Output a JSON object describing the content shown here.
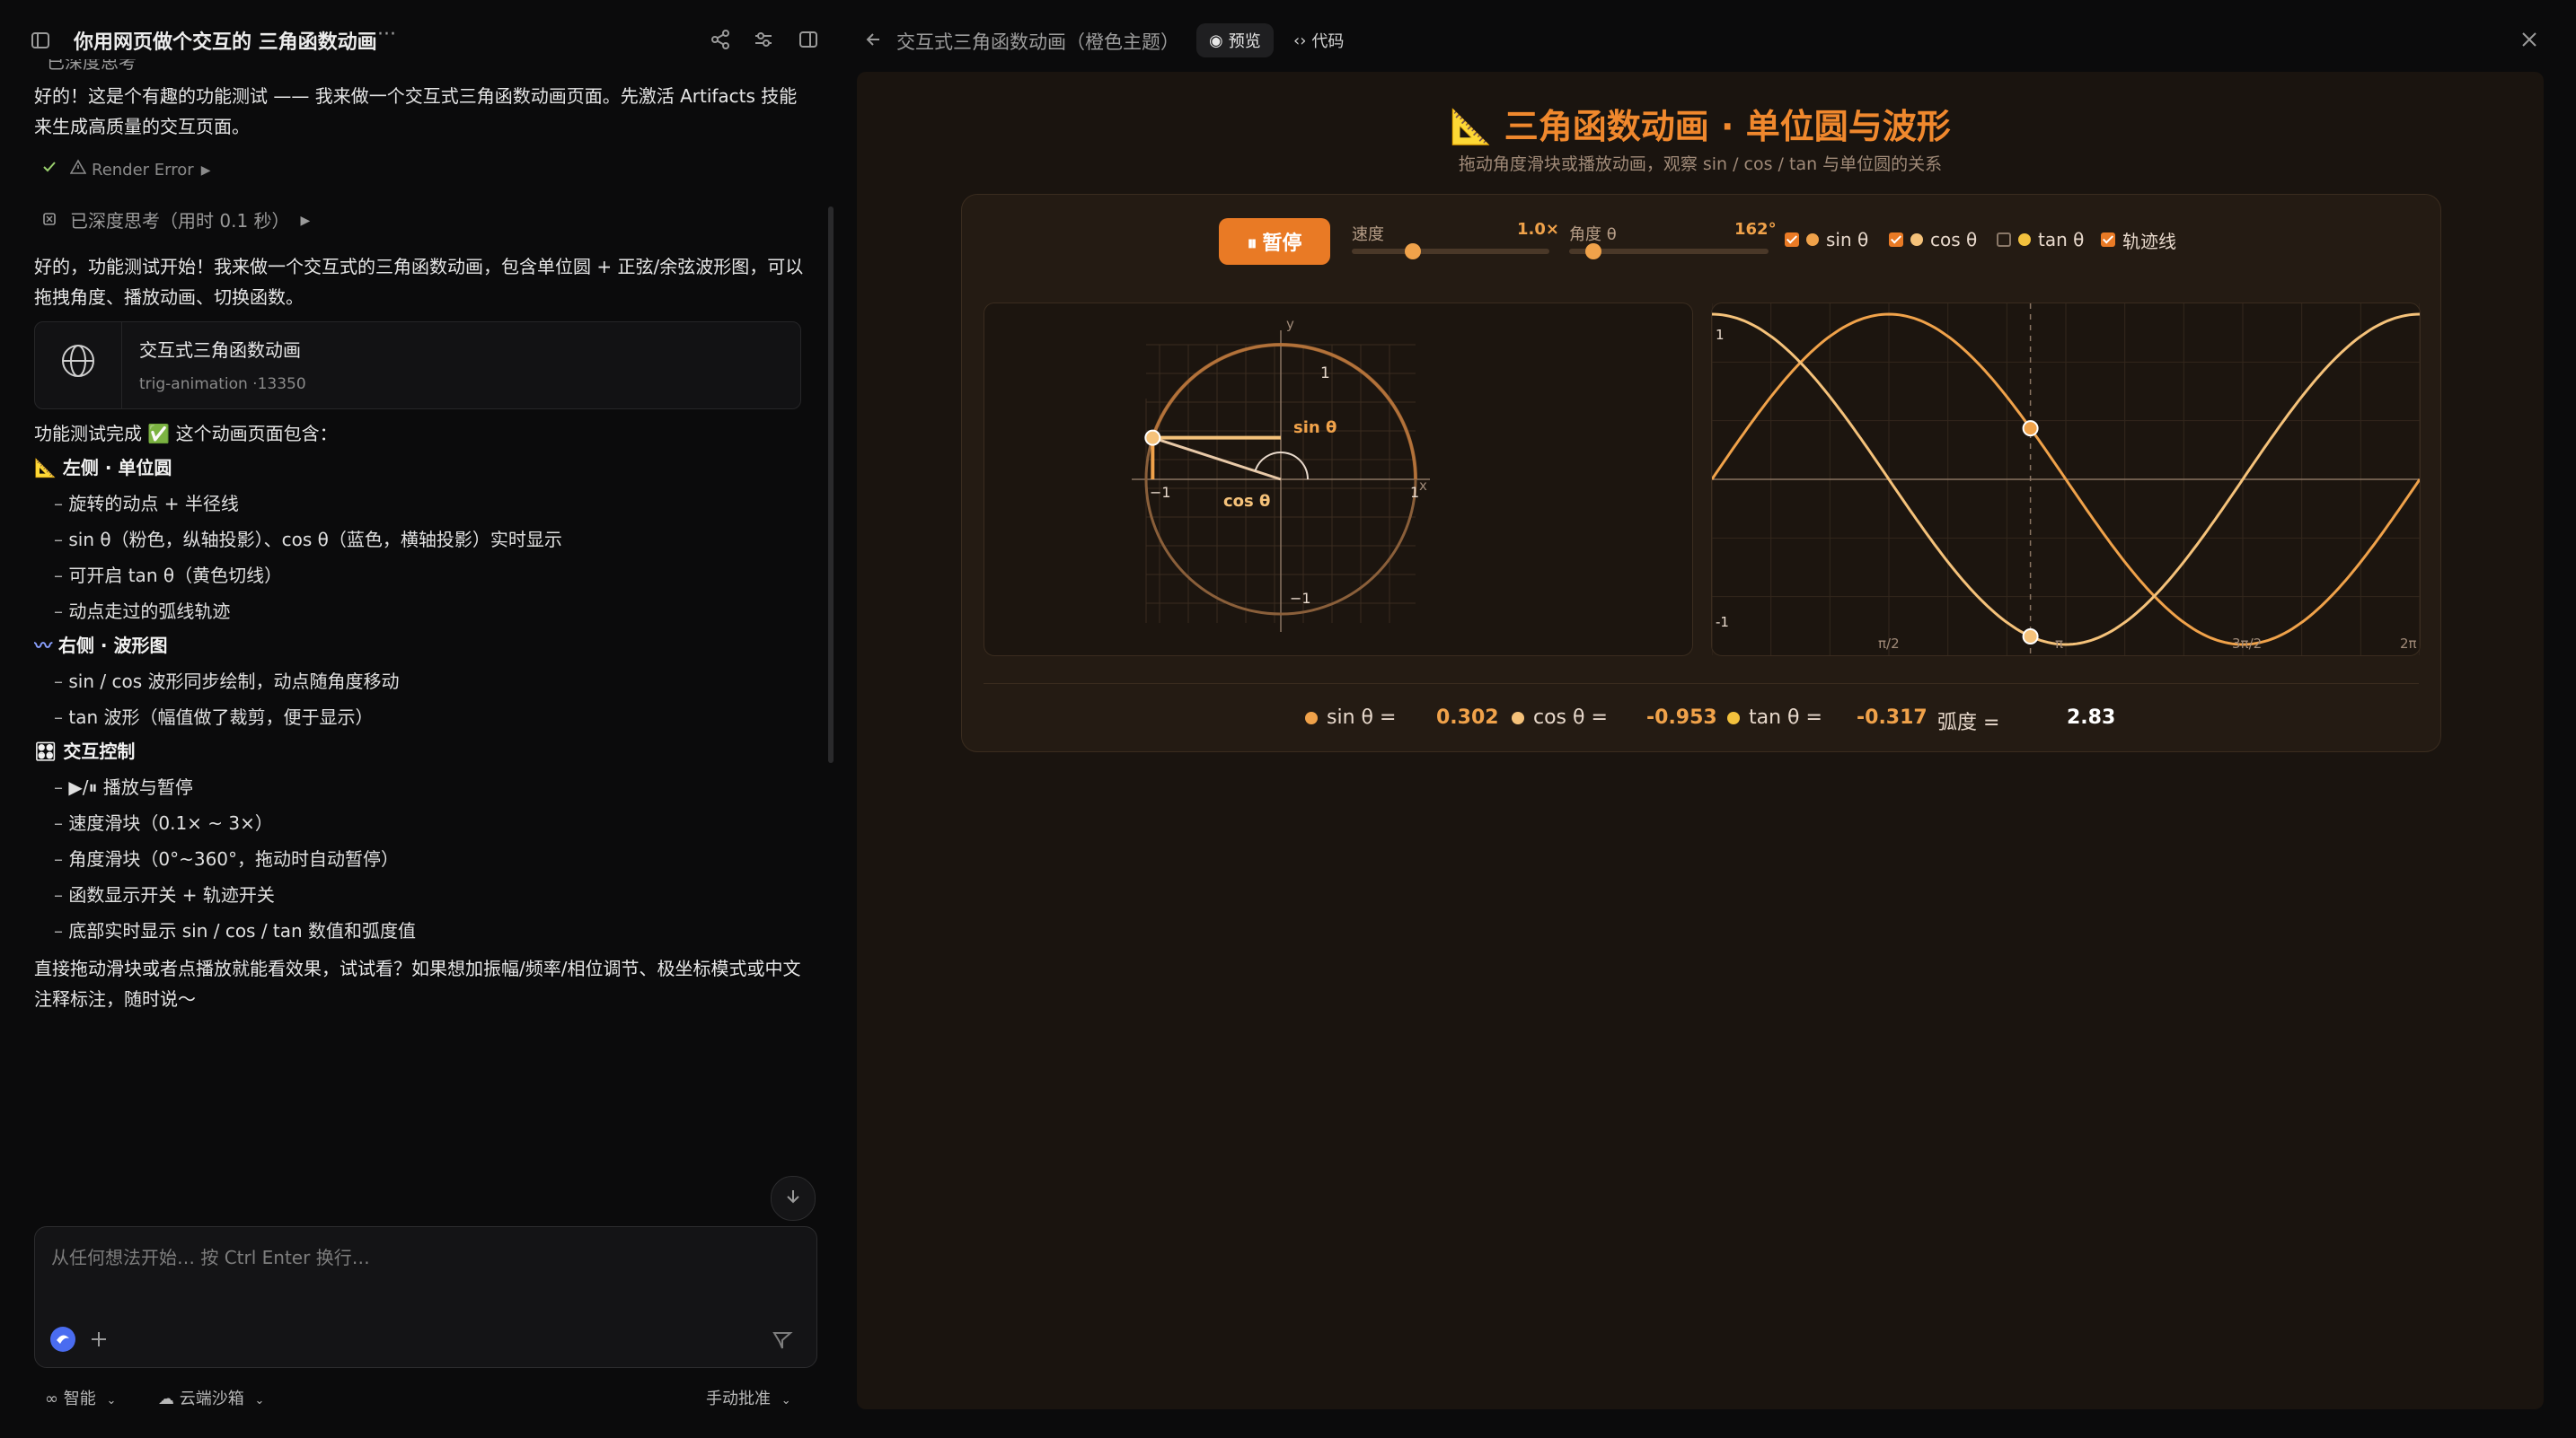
{
  "left": {
    "title": "你用网页做个交互的 三角函数动画",
    "more": "···",
    "top_partial": "已深度思考",
    "intro": "好的！这是个有趣的功能测试 —— 我来做一个交互式三角函数动画页面。先激活 Artifacts 技能来生成高质量的交互页面。",
    "render_error": "Render Error",
    "thinking": "已深度思考（用时 0.1 秒）",
    "reply1": "好的，功能测试开始！我来做一个交互式的三角函数动画，包含单位圆 + 正弦/余弦波形图，可以拖拽角度、播放动画、切换函数。",
    "artifact": {
      "title": "交互式三角函数动画",
      "meta": "trig-animation ·13350"
    },
    "done": "功能测试完成 ✅ 这个动画页面包含：",
    "sections": [
      {
        "icon": "📐",
        "heading": "左侧 · 单位圆",
        "items": [
          "旋转的动点 + 半径线",
          "sin θ（粉色，纵轴投影）、cos θ（蓝色，横轴投影）实时显示",
          "可开启 tan θ（黄色切线）",
          "动点走过的弧线轨迹"
        ]
      },
      {
        "icon": "〰",
        "heading": "右侧 · 波形图",
        "items": [
          "sin / cos 波形同步绘制，动点随角度移动",
          "tan 波形（幅值做了裁剪，便于显示）"
        ]
      },
      {
        "icon": "🎛",
        "heading": "交互控制",
        "items": [
          "▶/⏸ 播放与暂停",
          "速度滑块（0.1× ~ 3×）",
          "角度滑块（0°~360°，拖动时自动暂停）",
          "函数显示开关 + 轨迹开关",
          "底部实时显示 sin / cos / tan 数值和弧度值"
        ]
      }
    ],
    "closing": "直接拖动滑块或者点播放就能看效果，试试看？如果想加振幅/频率/相位调节、极坐标模式或中文注释标注，随时说～",
    "input_placeholder": "从任何想法开始… 按  Ctrl  Enter  换行…",
    "footer": {
      "mode": "智能",
      "sandbox": "云端沙箱",
      "approval": "手动批准"
    }
  },
  "right": {
    "title": "交互式三角函数动画（橙色主题）",
    "tab_preview": "预览",
    "tab_code": "代码",
    "page_title": "📐 三角函数动画 · 单位圆与波形",
    "page_subtitle": "拖动角度滑块或播放动画，观察 sin / cos / tan 与单位圆的关系",
    "pause_label": "⏸ 暂停",
    "speed_label": "速度",
    "speed_value": "1.0×",
    "speed_fraction": 0.31,
    "angle_label": "角度 θ",
    "angle_value": "162°",
    "angle_fraction": 0.12,
    "toggles": [
      {
        "label": "sin θ",
        "checked": true,
        "color": "#f0a24a"
      },
      {
        "label": "cos θ",
        "checked": true,
        "color": "#f5c27a"
      },
      {
        "label": "tan θ",
        "checked": false,
        "color": "#f3c13d"
      },
      {
        "label": "轨迹线",
        "checked": true
      }
    ],
    "readout": {
      "sin_label": "sin θ =",
      "sin_value": "0.302",
      "cos_label": "cos θ =",
      "cos_value": "-0.953",
      "tan_label": "tan θ =",
      "tan_value": "-0.317",
      "rad_label": "弧度 =",
      "rad_value": "2.83"
    },
    "circle_labels": {
      "sin": "sin θ",
      "cos": "cos θ",
      "y": "y",
      "x": "x",
      "one": "1",
      "neg_one": "−1"
    },
    "wave_ticks": [
      "π/2",
      "π",
      "3π/2",
      "2π"
    ],
    "wave_y": {
      "top": "1",
      "bottom": "-1"
    },
    "colors": {
      "accent": "#e97a25",
      "sin": "#f0a24a",
      "cos": "#f5c27a"
    }
  }
}
